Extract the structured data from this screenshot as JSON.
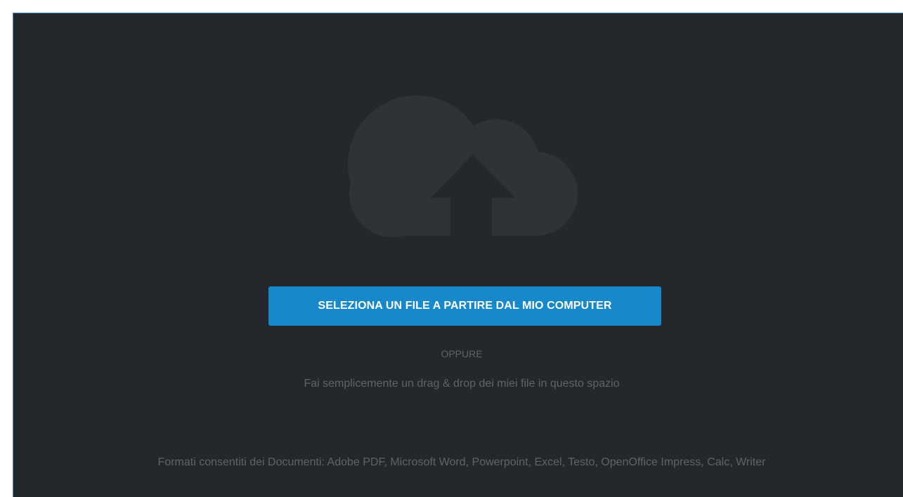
{
  "upload": {
    "icon": "cloud-upload-icon",
    "button_label": "SELEZIONA UN FILE A PARTIRE DAL MIO COMPUTER",
    "or_label": "OPPURE",
    "drag_hint": "Fai semplicemente un drag & drop dei miei file in questo spazio",
    "formats_note": "Formati consentiti dei Documenti: Adobe PDF, Microsoft Word, Powerpoint, Excel, Testo, OpenOffice Impress, Calc, Writer"
  },
  "colors": {
    "background": "#24272b",
    "icon": "#2f3338",
    "button": "#1788c9",
    "muted_text": "#5f6469",
    "border_accent": "#3a8fd6"
  }
}
